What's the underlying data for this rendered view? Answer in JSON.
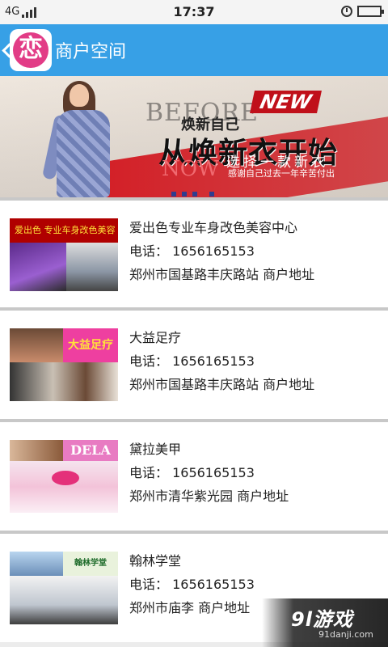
{
  "status_bar": {
    "network": "4G",
    "time": "17:37",
    "battery_percent": 100
  },
  "header": {
    "logo_text": "恋",
    "title": "商户空间"
  },
  "banner": {
    "before": "BEFORE",
    "new_tag": "NEW",
    "sub1": "焕新自己",
    "main": "从焕新衣开始",
    "now": "NOW",
    "sub2": "选择一款新衣",
    "sub3": "感谢自己过去一年辛苦付出",
    "active_dot": 0
  },
  "merchants": [
    {
      "name": "爱出色专业车身改色美容中心",
      "phone": "电话： 1656165153",
      "address": "郑州市国基路丰庆路站   商户地址",
      "thumb_label": "爱出色  专业车身改色美容中心"
    },
    {
      "name": "大益足疗",
      "phone": "电话： 1656165153",
      "address": "郑州市国基路丰庆路站   商户地址",
      "thumb_label": "大益足疗"
    },
    {
      "name": "黛拉美甲",
      "phone": "电话： 1656165153",
      "address": "郑州市清华紫光园   商户地址",
      "thumb_label": "DELA"
    },
    {
      "name": "翰林学堂",
      "phone": "电话： 1656165153",
      "address": "郑州市庙李   商户地址",
      "thumb_label": "翰林学堂"
    }
  ],
  "watermark": {
    "big": "9l游戏",
    "small": "91danji.com"
  }
}
